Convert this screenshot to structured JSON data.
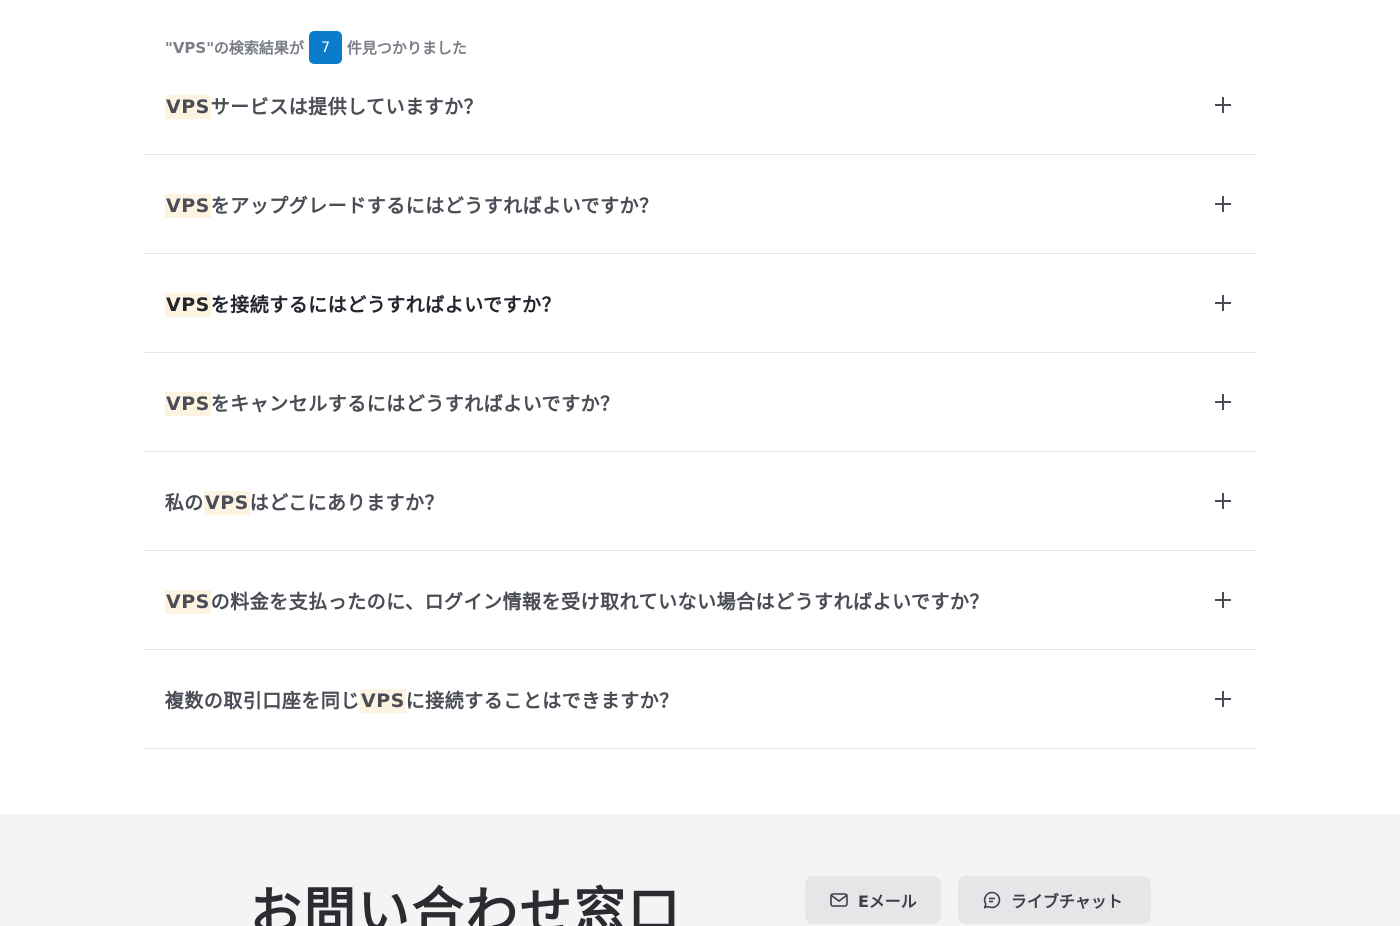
{
  "search_summary": {
    "prefix": "\"VPS\"の検索結果が",
    "count": "7",
    "suffix": "件見つかりました"
  },
  "faq": [
    {
      "highlight": "VPS",
      "before": "",
      "after": "サービスは提供していますか？"
    },
    {
      "highlight": "VPS",
      "before": "",
      "after": "をアップグレードするにはどうすればよいですか？"
    },
    {
      "highlight": "VPS",
      "before": "",
      "after": "を接続するにはどうすればよいですか？"
    },
    {
      "highlight": "VPS",
      "before": "",
      "after": "をキャンセルするにはどうすればよいですか？"
    },
    {
      "highlight": "VPS",
      "before": "私の",
      "after": "はどこにありますか？"
    },
    {
      "highlight": "VPS",
      "before": "",
      "after": "の料金を支払ったのに、ログイン情報を受け取れていない場合はどうすればよいですか？"
    },
    {
      "highlight": "VPS",
      "before": "複数の取引口座を同じ",
      "after": "に接続することはできますか？"
    }
  ],
  "contact": {
    "title": "お問い合わせ窓口",
    "email_label": "Eメール",
    "email_icon": "mail-icon",
    "chat_label": "ライブチャット",
    "chat_icon": "chat-bubble-icon"
  },
  "colors": {
    "badge": "#0a7ccc",
    "highlight": "#fdf3e1",
    "contact_bg": "#f4f4f5"
  }
}
